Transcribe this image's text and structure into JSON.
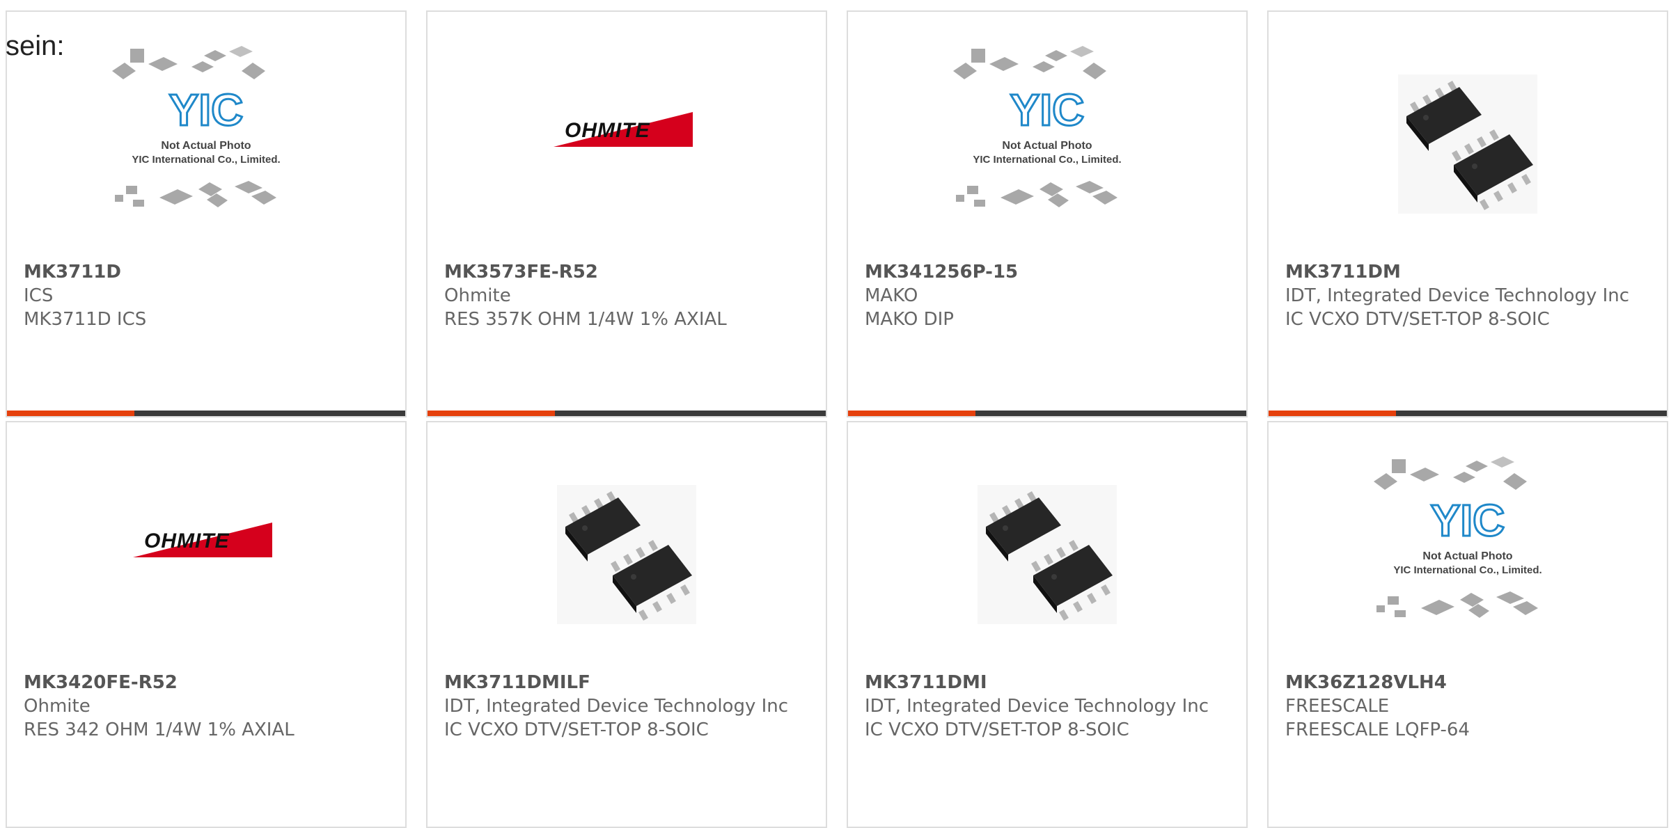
{
  "intro_text": "sein:",
  "colors": {
    "accent": "#e5400c",
    "bar": "#3a3a3a",
    "ohmite_red": "#d5001c",
    "yic_blue": "#1f88c9"
  },
  "placeholder": {
    "line1": "Not Actual Photo",
    "line2": "YIC International Co., Limited.",
    "logo": "YIC"
  },
  "ohmite_logo": "OHMITE",
  "products": [
    {
      "part": "MK3711D",
      "manufacturer": "ICS",
      "description": "MK3711D ICS",
      "image": "yic-placeholder"
    },
    {
      "part": "MK3573FE-R52",
      "manufacturer": "Ohmite",
      "description": "RES 357K OHM 1/4W 1% AXIAL",
      "image": "ohmite-logo"
    },
    {
      "part": "MK341256P-15",
      "manufacturer": "MAKO",
      "description": "MAKO DIP",
      "image": "yic-placeholder"
    },
    {
      "part": "MK3711DM",
      "manufacturer": "IDT, Integrated Device Technology Inc",
      "description": "IC VCXO DTV/SET-TOP 8-SOIC",
      "image": "soic-chip"
    },
    {
      "part": "MK3420FE-R52",
      "manufacturer": "Ohmite",
      "description": "RES 342 OHM 1/4W 1% AXIAL",
      "image": "ohmite-logo"
    },
    {
      "part": "MK3711DMILF",
      "manufacturer": "IDT, Integrated Device Technology Inc",
      "description": "IC VCXO DTV/SET-TOP 8-SOIC",
      "image": "soic-chip"
    },
    {
      "part": "MK3711DMI",
      "manufacturer": "IDT, Integrated Device Technology Inc",
      "description": "IC VCXO DTV/SET-TOP 8-SOIC",
      "image": "soic-chip"
    },
    {
      "part": "MK36Z128VLH4",
      "manufacturer": "FREESCALE",
      "description": "FREESCALE LQFP-64",
      "image": "yic-placeholder"
    }
  ]
}
